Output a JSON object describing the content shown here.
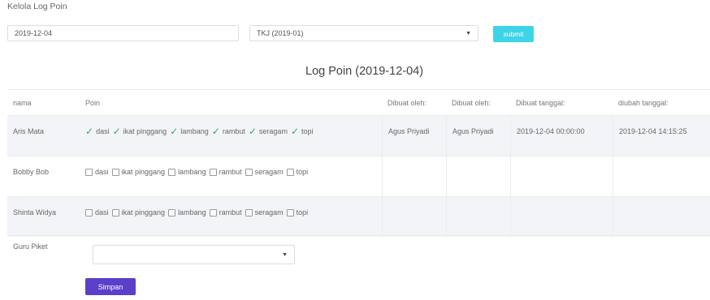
{
  "page": {
    "title": "Kelola Log Poin"
  },
  "filters": {
    "date_value": "2019-12-04",
    "class_value": "TKJ (2019-01)",
    "submit_label": "submit"
  },
  "table": {
    "title": "Log Poin (2019-12-04)",
    "headers": {
      "name": "nama",
      "poin": "Poin",
      "by1": "Dibuat oleh:",
      "by2": "Dibuat oleh:",
      "created": "Dibuat tanggal:",
      "updated": "diubah tanggal:"
    },
    "items": [
      "dasi",
      "ikat pinggang",
      "lambang",
      "rambut",
      "seragam",
      "topi"
    ],
    "rows": [
      {
        "name": "Aris Mata",
        "checked": true,
        "by1": "Agus Priyadi",
        "by2": "Agus Priyadi",
        "created": "2019-12-04 00:00:00",
        "updated": "2019-12-04 14:15:25"
      },
      {
        "name": "Bobby Bob",
        "checked": false,
        "by1": "",
        "by2": "",
        "created": "",
        "updated": ""
      },
      {
        "name": "Shinta Widya",
        "checked": false,
        "by1": "",
        "by2": "",
        "created": "",
        "updated": ""
      }
    ]
  },
  "footer": {
    "guru_label": "Guru Piket",
    "guru_value": "",
    "save_label": "Simpan"
  },
  "colors": {
    "submit": "#3dd4e8",
    "save": "#5b3fc9",
    "check": "#27ae60",
    "alt_row": "#f3f4f8"
  }
}
